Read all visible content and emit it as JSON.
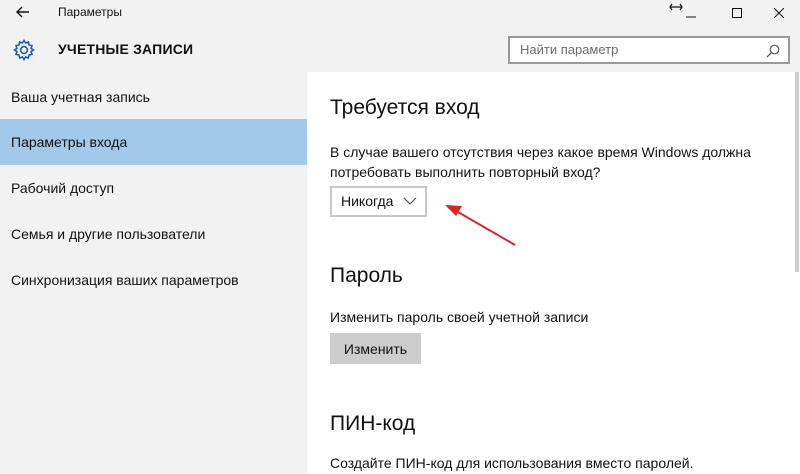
{
  "window": {
    "title": "Параметры"
  },
  "header": {
    "title": "УЧЕТНЫЕ ЗАПИСИ",
    "search_placeholder": "Найти параметр"
  },
  "sidebar": {
    "items": [
      {
        "label": "Ваша учетная запись",
        "active": false
      },
      {
        "label": "Параметры входа",
        "active": true
      },
      {
        "label": "Рабочий доступ",
        "active": false
      },
      {
        "label": "Семья и другие пользователи",
        "active": false
      },
      {
        "label": "Синхронизация ваших параметров",
        "active": false
      }
    ]
  },
  "main": {
    "signin": {
      "title": "Требуется вход",
      "description_line1": "В случае вашего отсутствия через какое время Windows должна",
      "description_line2": "потребовать выполнить повторный вход?",
      "dropdown_value": "Никогда"
    },
    "password": {
      "title": "Пароль",
      "description": "Изменить пароль своей учетной записи",
      "button_label": "Изменить"
    },
    "pin": {
      "title": "ПИН-код",
      "description": "Создайте ПИН-код для использования вместо паролей."
    }
  },
  "colors": {
    "active_item_bg": "#a2c9ea",
    "chrome_bg": "#f2f2f2",
    "annotation_arrow": "#d9262b"
  },
  "icons": [
    "back-arrow-icon",
    "minimize-icon",
    "maximize-icon",
    "close-icon",
    "gear-icon",
    "search-icon",
    "chevron-down-icon",
    "resize-cursor-icon"
  ]
}
